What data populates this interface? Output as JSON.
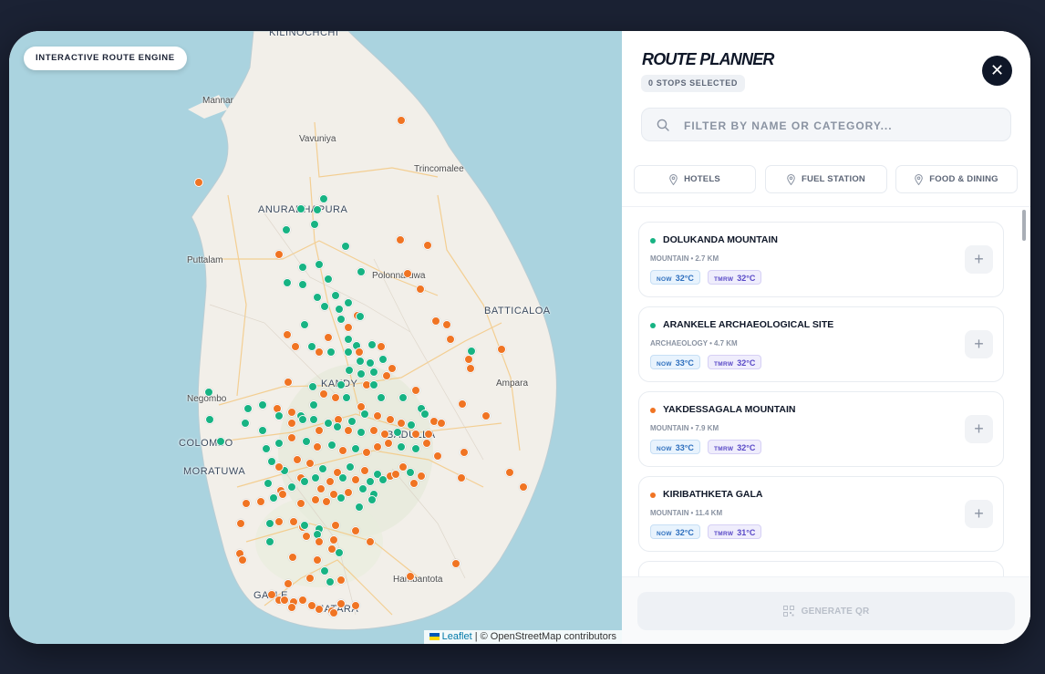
{
  "map": {
    "engine_label": "INTERACTIVE ROUTE ENGINE",
    "attribution_leaflet": "Leaflet",
    "attribution_rest": " | © OpenStreetMap contributors",
    "labels": [
      {
        "text": "KILINOCHCHI",
        "big": true
      },
      {
        "text": "Mannar",
        "big": false
      },
      {
        "text": "Vavuniya",
        "big": false
      },
      {
        "text": "Trincomalee",
        "big": false
      },
      {
        "text": "ANURADHAPURA",
        "big": true
      },
      {
        "text": "Puttalam",
        "big": false
      },
      {
        "text": "Polonnaruwa",
        "big": false
      },
      {
        "text": "BATTICALOA",
        "big": true
      },
      {
        "text": "Ampara",
        "big": false
      },
      {
        "text": "KANDY",
        "big": true
      },
      {
        "text": "Negombo",
        "big": false
      },
      {
        "text": "COLOMBO",
        "big": true
      },
      {
        "text": "MORATUWA",
        "big": true
      },
      {
        "text": "BADULLA",
        "big": true
      },
      {
        "text": "Hambantota",
        "big": false
      },
      {
        "text": "GALLE",
        "big": true
      },
      {
        "text": "MATARA",
        "big": true
      }
    ],
    "colors": {
      "green": "#17b383",
      "orange": "#f07423",
      "sea": "#aad3df",
      "land": "#f2efe9"
    }
  },
  "panel": {
    "title": "ROUTE PLANNER",
    "stops_badge": "0 STOPS SELECTED",
    "close_icon": "close-icon",
    "search_placeholder": "FILTER BY NAME OR CATEGORY...",
    "filters": [
      {
        "label": "HOTELS",
        "icon": "location-pin-icon"
      },
      {
        "label": "FUEL STATION",
        "icon": "location-pin-icon"
      },
      {
        "label": "FOOD & DINING",
        "icon": "location-pin-icon"
      }
    ],
    "now_label": "NOW",
    "tmrw_label": "TMRW",
    "places": [
      {
        "name": "DOLUKANDA MOUNTAIN",
        "category": "MOUNTAIN",
        "distance": "2.7 KM",
        "now": "32°C",
        "tmrw": "32°C",
        "color": "#17b383"
      },
      {
        "name": "ARANKELE ARCHAEOLOGICAL SITE",
        "category": "ARCHAEOLOGY",
        "distance": "4.7 KM",
        "now": "33°C",
        "tmrw": "32°C",
        "color": "#17b383"
      },
      {
        "name": "YAKDESSAGALA MOUNTAIN",
        "category": "MOUNTAIN",
        "distance": "7.9 KM",
        "now": "33°C",
        "tmrw": "32°C",
        "color": "#f07423"
      },
      {
        "name": "KIRIBATHKETA GALA",
        "category": "MOUNTAIN",
        "distance": "11.4 KM",
        "now": "32°C",
        "tmrw": "31°C",
        "color": "#f07423"
      }
    ],
    "generate_label": "GENERATE QR",
    "add_label": "+"
  }
}
